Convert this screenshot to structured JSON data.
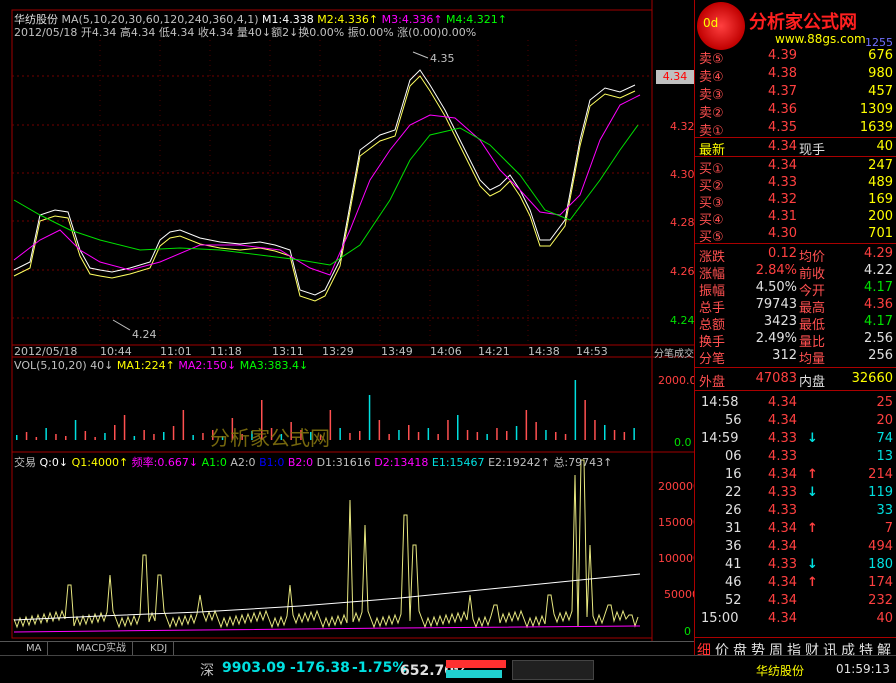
{
  "stock": {
    "name": "华纺股份",
    "ma_params": "MA(5,10,20,30,60,120,240,360,4,1)",
    "m1": "M1:4.338",
    "m2": "M2:4.336↑",
    "m3": "M3:4.336↑",
    "m4": "M4:4.321↑",
    "info_line": "2012/05/18 开4.34 高4.34 低4.34 收4.34 量40↓额2↓换0.00% 振0.00% 涨(0.00)0.00%",
    "high_mark": "4.35",
    "low_mark": "4.24",
    "current_price_tag": "4.34",
    "price_axis": [
      "4.34",
      "4.32",
      "4.30",
      "4.28",
      "4.26",
      "4.24"
    ],
    "time_axis": [
      "2012/05/18",
      "10:44",
      "11:01",
      "11:18",
      "13:11",
      "13:29",
      "13:49",
      "14:06",
      "14:21",
      "14:38",
      "14:53"
    ],
    "time_axis_right_label": "分笔成交",
    "vol_header": "VOL(5,10,20) 40↓",
    "vol_ma1": "MA1:224↑",
    "vol_ma2": "MA2:150↓",
    "vol_ma3": "MA3:383.4↓",
    "vol_axis": [
      "2000.0",
      "0.0"
    ],
    "trade_header_prefix": "交易",
    "trade_q0": "Q:0↓",
    "trade_q1": "Q1:4000↑",
    "trade_freq": "频率:0.667↓",
    "trade_a1": "A1:0",
    "trade_a2": "A2:0",
    "trade_b1": "B1:0",
    "trade_b2": "B2:0",
    "trade_d1": "D1:31616",
    "trade_d2": "D2:13418",
    "trade_e1": "E1:15467",
    "trade_e2": "E2:19242↑",
    "trade_total": "总:79743↑",
    "trade_axis": [
      "200000",
      "150000",
      "100000",
      "50000",
      "0"
    ],
    "watermark": "分析家公式网"
  },
  "logo": {
    "text": "分析家公式网",
    "url": "www.88gs.com",
    "header_cut": "0d",
    "header_cut_right": "1255"
  },
  "orderbook": {
    "sell": [
      {
        "label": "卖⑤",
        "price": "4.39",
        "vol": "676"
      },
      {
        "label": "卖④",
        "price": "4.38",
        "vol": "980"
      },
      {
        "label": "卖③",
        "price": "4.37",
        "vol": "457"
      },
      {
        "label": "卖②",
        "price": "4.36",
        "vol": "1309"
      },
      {
        "label": "卖①",
        "price": "4.35",
        "vol": "1639"
      }
    ],
    "latest": {
      "label": "最新",
      "price": "4.34",
      "label2": "现手",
      "vol": "40"
    },
    "buy": [
      {
        "label": "买①",
        "price": "4.34",
        "vol": "247"
      },
      {
        "label": "买②",
        "price": "4.33",
        "vol": "489"
      },
      {
        "label": "买③",
        "price": "4.32",
        "vol": "169"
      },
      {
        "label": "买④",
        "price": "4.31",
        "vol": "200"
      },
      {
        "label": "买⑤",
        "price": "4.30",
        "vol": "701"
      }
    ]
  },
  "stats": [
    {
      "l1": "涨跌",
      "v1": "0.12",
      "l2": "均价",
      "v2": "4.29",
      "c1": "red",
      "c2": "red"
    },
    {
      "l1": "涨幅",
      "v1": "2.84%",
      "l2": "前收",
      "v2": "4.22",
      "c1": "red",
      "c2": "white"
    },
    {
      "l1": "振幅",
      "v1": "4.50%",
      "l2": "今开",
      "v2": "4.17",
      "c1": "white",
      "c2": "green"
    },
    {
      "l1": "总手",
      "v1": "79743",
      "l2": "最高",
      "v2": "4.36",
      "c1": "white",
      "c2": "red"
    },
    {
      "l1": "总额",
      "v1": "3423",
      "l2": "最低",
      "v2": "4.17",
      "c1": "white",
      "c2": "green"
    },
    {
      "l1": "换手",
      "v1": "2.49%",
      "l2": "量比",
      "v2": "2.56",
      "c1": "white",
      "c2": "white"
    },
    {
      "l1": "分笔",
      "v1": "312",
      "l2": "均量",
      "v2": "256",
      "c1": "white",
      "c2": "white"
    }
  ],
  "outer_inner": {
    "l1": "外盘",
    "v1": "47083",
    "l2": "内盘",
    "v2": "32660"
  },
  "ticks": [
    {
      "t": "14:58",
      "p": "4.34",
      "arrow": "",
      "v": "25",
      "pc": "red",
      "vc": "red"
    },
    {
      "t": "56",
      "p": "4.34",
      "arrow": "",
      "v": "20",
      "pc": "red",
      "vc": "red"
    },
    {
      "t": "14:59",
      "p": "4.33",
      "arrow": "↓",
      "v": "74",
      "pc": "red",
      "vc": "cyan"
    },
    {
      "t": "06",
      "p": "4.33",
      "arrow": "",
      "v": "13",
      "pc": "red",
      "vc": "cyan"
    },
    {
      "t": "16",
      "p": "4.34",
      "arrow": "↑",
      "v": "214",
      "pc": "red",
      "vc": "red"
    },
    {
      "t": "22",
      "p": "4.33",
      "arrow": "↓",
      "v": "119",
      "pc": "red",
      "vc": "cyan"
    },
    {
      "t": "26",
      "p": "4.33",
      "arrow": "",
      "v": "33",
      "pc": "red",
      "vc": "cyan"
    },
    {
      "t": "31",
      "p": "4.34",
      "arrow": "↑",
      "v": "7",
      "pc": "red",
      "vc": "red"
    },
    {
      "t": "36",
      "p": "4.34",
      "arrow": "",
      "v": "494",
      "pc": "red",
      "vc": "red"
    },
    {
      "t": "41",
      "p": "4.33",
      "arrow": "↓",
      "v": "180",
      "pc": "red",
      "vc": "cyan"
    },
    {
      "t": "46",
      "p": "4.34",
      "arrow": "↑",
      "v": "174",
      "pc": "red",
      "vc": "red"
    },
    {
      "t": "52",
      "p": "4.34",
      "arrow": "",
      "v": "232",
      "pc": "red",
      "vc": "red"
    },
    {
      "t": "15:00",
      "p": "4.34",
      "arrow": "",
      "v": "40",
      "pc": "red",
      "vc": "red"
    }
  ],
  "panel_tabs": [
    "细",
    "价",
    "盘",
    "势",
    "周",
    "指",
    "财",
    "讯",
    "成",
    "特",
    "解"
  ],
  "bottom_tabs": [
    "MA",
    "MACD实战",
    "KDJ"
  ],
  "status": {
    "index_name": "深",
    "index_value": "9903.09",
    "index_change": "-176.38",
    "index_pct": "-1.75%",
    "index_amount": "652.70亿",
    "stock_name": "华纺股份",
    "time": "01:59:13"
  },
  "colors": {
    "up": "#ff3b3b",
    "down": "#00ffff",
    "ma1": "#ffffff",
    "ma2": "#ffff00",
    "ma3": "#ff00ff",
    "ma4": "#00ff00",
    "grid": "#a00000"
  }
}
